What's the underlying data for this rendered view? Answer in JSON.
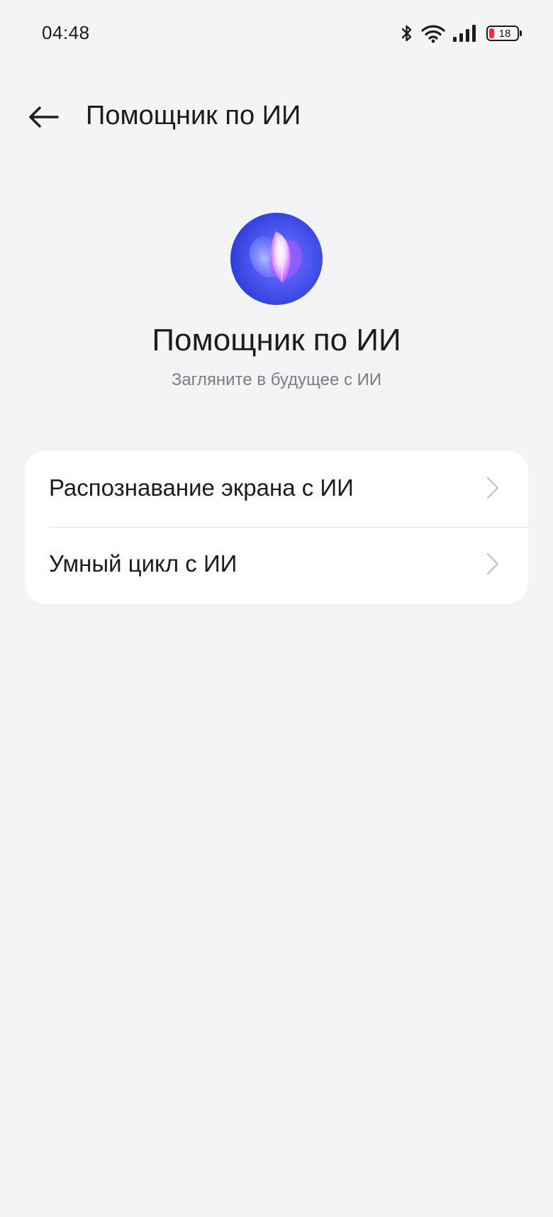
{
  "status_bar": {
    "time": "04:48",
    "battery_level": "18",
    "icons": [
      "bluetooth-icon",
      "wifi-icon",
      "signal-icon",
      "battery-icon"
    ]
  },
  "header": {
    "title": "Помощник по ИИ",
    "back_icon": "arrow-left-icon"
  },
  "hero": {
    "title": "Помощник по ИИ",
    "subtitle": "Загляните в будущее с ИИ",
    "logo_icon": "ai-assistant-logo-icon"
  },
  "list": {
    "items": [
      {
        "label": "Распознавание экрана с ИИ",
        "icon": "chevron-right-icon"
      },
      {
        "label": "Умный цикл с ИИ",
        "icon": "chevron-right-icon"
      }
    ]
  },
  "colors": {
    "background": "#f3f4f6",
    "card": "#ffffff",
    "text_primary": "#1c1c1e",
    "text_secondary": "#7b7d82",
    "battery_low": "#e5323a",
    "logo_blue": "#3a52e6"
  }
}
